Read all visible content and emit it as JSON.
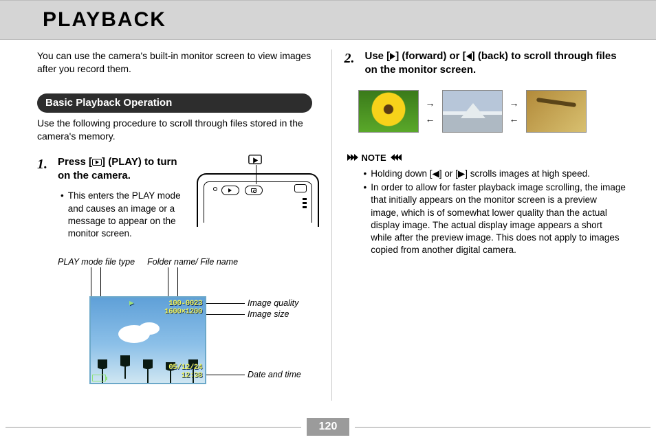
{
  "title": "PLAYBACK",
  "intro": "You can use the camera's built-in monitor screen to view images after you record them.",
  "section": {
    "heading": "Basic Playback Operation",
    "sub": "Use the following procedure to scroll through files stored in the camera's memory."
  },
  "step1": {
    "num": "1.",
    "title_a": "Press [",
    "title_b": "] (PLAY) to turn on the camera.",
    "bullet": "This enters the PLAY mode and causes an image or a message to appear on the monitor screen."
  },
  "labels": {
    "top_left": "PLAY mode file type",
    "top_right": "Folder name/ File name",
    "quality": "Image quality",
    "size": "Image size",
    "datetime": "Date and time"
  },
  "lcd": {
    "folder": "100-0023",
    "resolution": "1600×1200",
    "date": "05/12/24",
    "time": "12:38"
  },
  "step2": {
    "num": "2.",
    "title_a": "Use [",
    "title_b": "] (forward) or [",
    "title_c": "] (back) to scroll through files on the monitor screen."
  },
  "note": {
    "label": "NOTE",
    "items": [
      "Holding down [◀] or [▶] scrolls images at high speed.",
      "In order to allow for faster playback image scrolling, the image that initially appears on the monitor screen is a preview image, which is of somewhat lower quality than the actual display image. The actual display image appears a short while after the preview image. This does not apply to images copied from another digital camera."
    ]
  },
  "arrows": {
    "right": "→",
    "left": "←"
  },
  "page_number": "120"
}
